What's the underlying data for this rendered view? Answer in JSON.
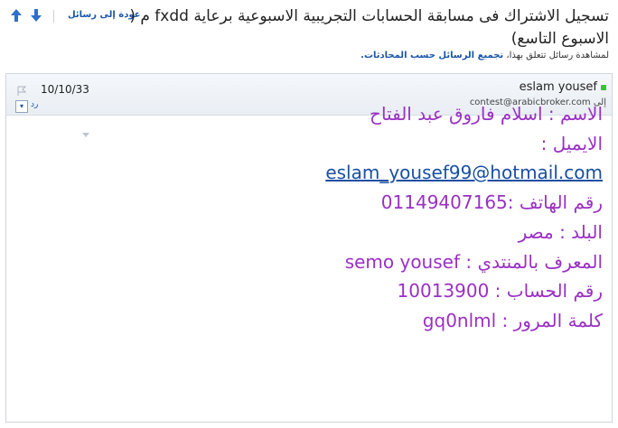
{
  "toolbar": {
    "back_label": "عودة إلى رسائل"
  },
  "message": {
    "subject": "تسجيل الاشتراك فى مسابقة الحسابات التجريبية الاسبوعية برعاية fxdd م ( الاسبوع التاسع)",
    "conversation_prefix": "لمشاهدة رسائل تتعلق بهذا،",
    "conversation_link": "تجميع الرسائل حسب المحادثات."
  },
  "header": {
    "sender": "eslam yousef",
    "to_label": "إلى",
    "to_address": "contest@arabicbroker.com",
    "date": "10/10/33",
    "reply_label": "رد"
  },
  "body": {
    "name": "الاسم :   اسلام فاروق عبد الفتاح",
    "email_label": "الايميل :",
    "email_value": "eslam_yousef99@hotmail.com",
    "phone": "رقم الهاتف :01149407165",
    "country": "البلد :  مصر",
    "forum_id": "المعرف بالمنتدي :  semo yousef",
    "account": "رقم الحساب :  10013900",
    "password": "كلمة المرور :   gq0nlml"
  },
  "colors": {
    "body_text": "#9a30c4",
    "link": "#1a56a8",
    "online": "#3cbf3a"
  }
}
